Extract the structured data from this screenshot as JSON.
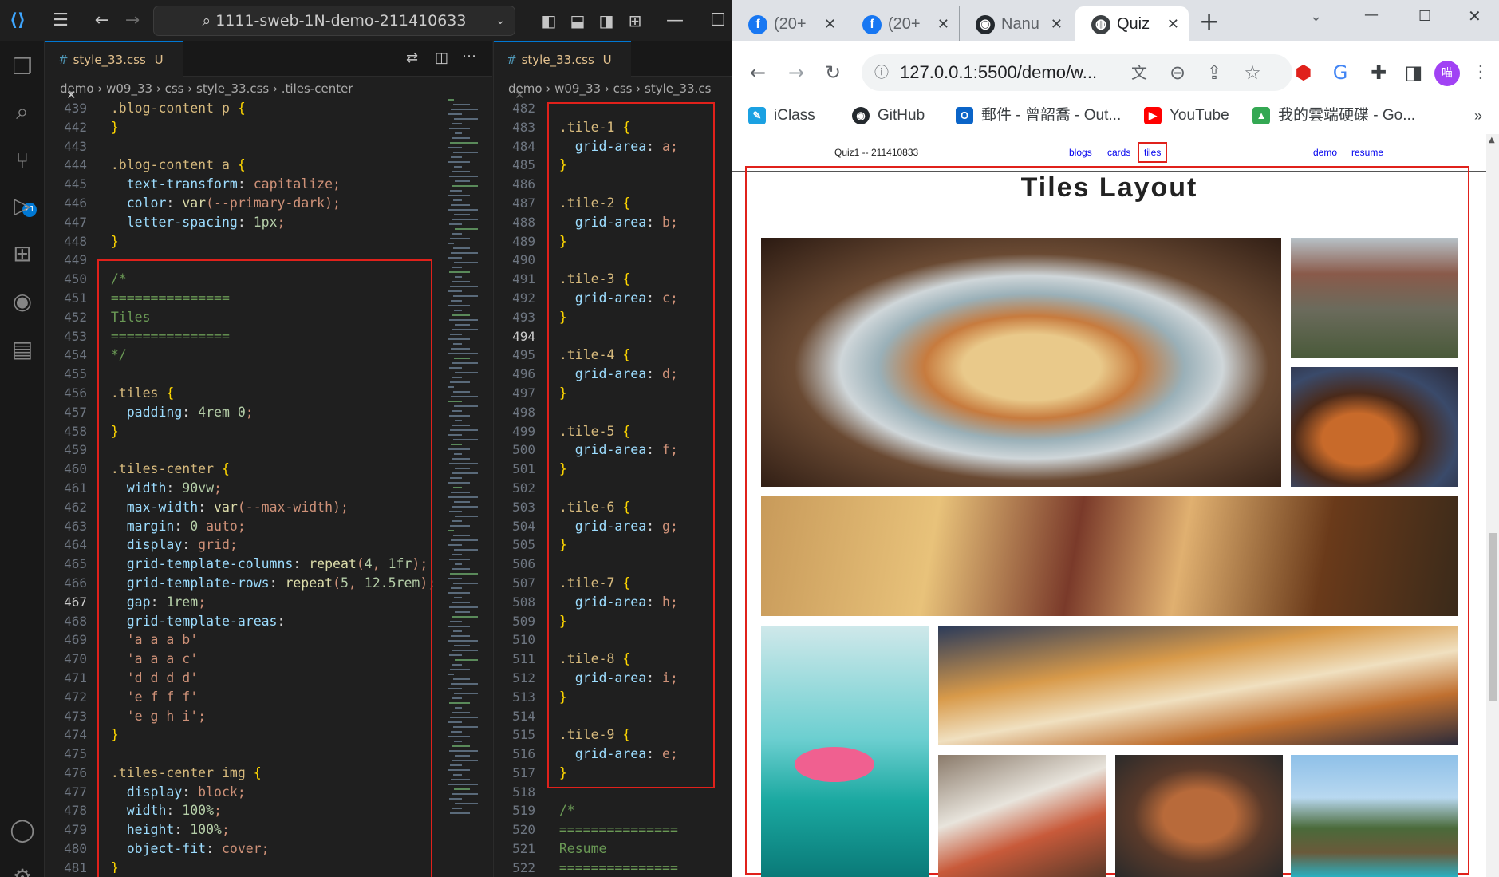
{
  "vscode": {
    "command_center": "1111-sweb-1N-demo-211410633",
    "scm_badge": "21",
    "left_editor": {
      "tab_label": "style_33.css",
      "tab_status": "U",
      "breadcrumb": [
        "demo",
        "w09_33",
        "css",
        "style_33.css",
        ".tiles-center"
      ],
      "lines": [
        {
          "n": "439",
          "t": "  .blog-content p {"
        },
        {
          "n": "442",
          "t": "  }"
        },
        {
          "n": "443",
          "t": ""
        },
        {
          "n": "444",
          "t": "  .blog-content a {"
        },
        {
          "n": "445",
          "t": "    text-transform: capitalize;"
        },
        {
          "n": "446",
          "t": "    color: var(--primary-dark);"
        },
        {
          "n": "447",
          "t": "    letter-spacing: 1px;"
        },
        {
          "n": "448",
          "t": "  }"
        },
        {
          "n": "449",
          "t": ""
        },
        {
          "n": "450",
          "t": "  /*"
        },
        {
          "n": "451",
          "t": "  ==============="
        },
        {
          "n": "452",
          "t": "  Tiles"
        },
        {
          "n": "453",
          "t": "  ==============="
        },
        {
          "n": "454",
          "t": "  */"
        },
        {
          "n": "455",
          "t": ""
        },
        {
          "n": "456",
          "t": "  .tiles {"
        },
        {
          "n": "457",
          "t": "    padding: 4rem 0;"
        },
        {
          "n": "458",
          "t": "  }"
        },
        {
          "n": "459",
          "t": ""
        },
        {
          "n": "460",
          "t": "  .tiles-center {"
        },
        {
          "n": "461",
          "t": "    width: 90vw;"
        },
        {
          "n": "462",
          "t": "    max-width: var(--max-width);"
        },
        {
          "n": "463",
          "t": "    margin: 0 auto;"
        },
        {
          "n": "464",
          "t": "    display: grid;"
        },
        {
          "n": "465",
          "t": "    grid-template-columns: repeat(4, 1fr);"
        },
        {
          "n": "466",
          "t": "    grid-template-rows: repeat(5, 12.5rem);"
        },
        {
          "n": "467",
          "t": "    gap: 1rem;"
        },
        {
          "n": "468",
          "t": "    grid-template-areas:"
        },
        {
          "n": "469",
          "t": "    'a a a b'"
        },
        {
          "n": "470",
          "t": "    'a a a c'"
        },
        {
          "n": "471",
          "t": "    'd d d d'"
        },
        {
          "n": "472",
          "t": "    'e f f f'"
        },
        {
          "n": "473",
          "t": "    'e g h i';"
        },
        {
          "n": "474",
          "t": "  }"
        },
        {
          "n": "475",
          "t": ""
        },
        {
          "n": "476",
          "t": "  .tiles-center img {"
        },
        {
          "n": "477",
          "t": "    display: block;"
        },
        {
          "n": "478",
          "t": "    width: 100%;"
        },
        {
          "n": "479",
          "t": "    height: 100%;"
        },
        {
          "n": "480",
          "t": "    object-fit: cover;"
        },
        {
          "n": "481",
          "t": "  }"
        },
        {
          "n": "482",
          "t": ""
        }
      ]
    },
    "right_editor": {
      "tab_label": "style_33.css",
      "tab_status": "U",
      "breadcrumb": [
        "demo",
        "w09_33",
        "css",
        "style_33.cs"
      ],
      "lines": [
        {
          "n": "482",
          "t": ""
        },
        {
          "n": "483",
          "t": "  .tile-1 {"
        },
        {
          "n": "484",
          "t": "    grid-area: a;"
        },
        {
          "n": "485",
          "t": "  }"
        },
        {
          "n": "486",
          "t": ""
        },
        {
          "n": "487",
          "t": "  .tile-2 {"
        },
        {
          "n": "488",
          "t": "    grid-area: b;"
        },
        {
          "n": "489",
          "t": "  }"
        },
        {
          "n": "490",
          "t": ""
        },
        {
          "n": "491",
          "t": "  .tile-3 {"
        },
        {
          "n": "492",
          "t": "    grid-area: c;"
        },
        {
          "n": "493",
          "t": "  }"
        },
        {
          "n": "494",
          "t": ""
        },
        {
          "n": "495",
          "t": "  .tile-4 {"
        },
        {
          "n": "496",
          "t": "    grid-area: d;"
        },
        {
          "n": "497",
          "t": "  }"
        },
        {
          "n": "498",
          "t": ""
        },
        {
          "n": "499",
          "t": "  .tile-5 {"
        },
        {
          "n": "500",
          "t": "    grid-area: f;"
        },
        {
          "n": "501",
          "t": "  }"
        },
        {
          "n": "502",
          "t": ""
        },
        {
          "n": "503",
          "t": "  .tile-6 {"
        },
        {
          "n": "504",
          "t": "    grid-area: g;"
        },
        {
          "n": "505",
          "t": "  }"
        },
        {
          "n": "506",
          "t": ""
        },
        {
          "n": "507",
          "t": "  .tile-7 {"
        },
        {
          "n": "508",
          "t": "    grid-area: h;"
        },
        {
          "n": "509",
          "t": "  }"
        },
        {
          "n": "510",
          "t": ""
        },
        {
          "n": "511",
          "t": "  .tile-8 {"
        },
        {
          "n": "512",
          "t": "    grid-area: i;"
        },
        {
          "n": "513",
          "t": "  }"
        },
        {
          "n": "514",
          "t": ""
        },
        {
          "n": "515",
          "t": "  .tile-9 {"
        },
        {
          "n": "516",
          "t": "    grid-area: e;"
        },
        {
          "n": "517",
          "t": "  }"
        },
        {
          "n": "518",
          "t": ""
        },
        {
          "n": "519",
          "t": "  /*"
        },
        {
          "n": "520",
          "t": "  ==============="
        },
        {
          "n": "521",
          "t": "  Resume"
        },
        {
          "n": "522",
          "t": "  ==============="
        }
      ]
    }
  },
  "chrome": {
    "tabs": [
      {
        "label": "(20+",
        "icon": "facebook-icon"
      },
      {
        "label": "(20+",
        "icon": "facebook-icon"
      },
      {
        "label": "Nanu",
        "icon": "github-icon"
      },
      {
        "label": "Quiz",
        "icon": "globe-icon"
      }
    ],
    "url": "127.0.0.1:5500/demo/w...",
    "bookmarks": [
      {
        "label": "iClass",
        "icon": "iclass-icon",
        "color": "#1ba1e2"
      },
      {
        "label": "GitHub",
        "icon": "github-icon",
        "color": "#24292e"
      },
      {
        "label": "郵件 - 曾韶喬 - Out...",
        "icon": "outlook-icon",
        "color": "#0a64c8"
      },
      {
        "label": "YouTube",
        "icon": "youtube-icon",
        "color": "#ff0000"
      },
      {
        "label": "我的雲端硬碟 - Go...",
        "icon": "google-drive-icon",
        "color": "#34a853"
      }
    ],
    "profile_initial": "喵",
    "page": {
      "nav_brand": "Quiz1 -- 211410833",
      "nav_links": [
        "blogs",
        "cards",
        "tiles"
      ],
      "nav_right": [
        "demo",
        "resume"
      ],
      "heading": "Tiles Layout"
    }
  }
}
